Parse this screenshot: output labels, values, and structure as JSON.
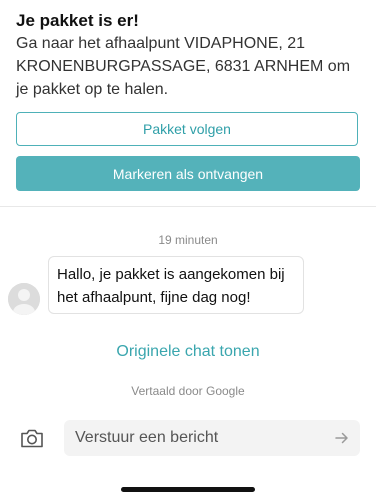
{
  "status": {
    "title": "Je pakket is er!",
    "body": "Ga naar het afhaalpunt VIDAPHONE, 21 KRONENBURGPASSAGE, 6831 ARNHEM om je pakket op te halen.",
    "track_button": "Pakket volgen",
    "mark_received_button": "Markeren als ontvangen"
  },
  "chat": {
    "timestamp": "19 minuten",
    "message": "Hallo, je pakket is aangekomen bij het afhaalpunt, fijne dag nog!",
    "show_original": "Originele chat tonen",
    "translated_by": "Vertaald door Google"
  },
  "composer": {
    "placeholder": "Verstuur een bericht",
    "camera_icon": "camera-icon",
    "send_icon": "send-arrow-icon"
  },
  "colors": {
    "accent": "#54b2ba",
    "accent_text": "#2f9fa8",
    "muted_text": "#8a8a8a"
  }
}
